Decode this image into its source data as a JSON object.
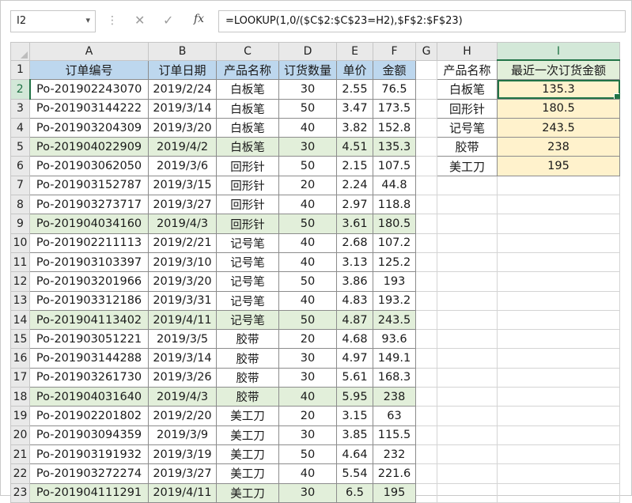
{
  "formula_bar": {
    "name_box": "I2",
    "name_box_arrow": "▾",
    "separator": "⋮",
    "cancel_icon": "✕",
    "confirm_icon": "✓",
    "fx_label": "fx",
    "formula": "=LOOKUP(1,0/($C$2:$C$23=H2),$F$2:$F$23)"
  },
  "columns": [
    "A",
    "B",
    "C",
    "D",
    "E",
    "F",
    "G",
    "H",
    "I"
  ],
  "selected_column": "I",
  "row_numbers": [
    "1",
    "2",
    "3",
    "4",
    "5",
    "6",
    "7",
    "8",
    "9",
    "10",
    "11",
    "12",
    "13",
    "14",
    "15",
    "16",
    "17",
    "18",
    "19",
    "20",
    "21",
    "22",
    "23"
  ],
  "selected_row": "2",
  "headers": [
    "订单编号",
    "订单日期",
    "产品名称",
    "订货数量",
    "单价",
    "金额"
  ],
  "orders": [
    {
      "id": "Po-201902243070",
      "date": "2019/2/24",
      "product": "白板笔",
      "qty": "30",
      "price": "2.55",
      "amount": "76.5",
      "latest": false
    },
    {
      "id": "Po-201903144222",
      "date": "2019/3/14",
      "product": "白板笔",
      "qty": "50",
      "price": "3.47",
      "amount": "173.5",
      "latest": false
    },
    {
      "id": "Po-201903204309",
      "date": "2019/3/20",
      "product": "白板笔",
      "qty": "40",
      "price": "3.82",
      "amount": "152.8",
      "latest": false
    },
    {
      "id": "Po-201904022909",
      "date": "2019/4/2",
      "product": "白板笔",
      "qty": "30",
      "price": "4.51",
      "amount": "135.3",
      "latest": true
    },
    {
      "id": "Po-201903062050",
      "date": "2019/3/6",
      "product": "回形针",
      "qty": "50",
      "price": "2.15",
      "amount": "107.5",
      "latest": false
    },
    {
      "id": "Po-201903152787",
      "date": "2019/3/15",
      "product": "回形针",
      "qty": "20",
      "price": "2.24",
      "amount": "44.8",
      "latest": false
    },
    {
      "id": "Po-201903273717",
      "date": "2019/3/27",
      "product": "回形针",
      "qty": "40",
      "price": "2.97",
      "amount": "118.8",
      "latest": false
    },
    {
      "id": "Po-201904034160",
      "date": "2019/4/3",
      "product": "回形针",
      "qty": "50",
      "price": "3.61",
      "amount": "180.5",
      "latest": true
    },
    {
      "id": "Po-201902211113",
      "date": "2019/2/21",
      "product": "记号笔",
      "qty": "40",
      "price": "2.68",
      "amount": "107.2",
      "latest": false
    },
    {
      "id": "Po-201903103397",
      "date": "2019/3/10",
      "product": "记号笔",
      "qty": "40",
      "price": "3.13",
      "amount": "125.2",
      "latest": false
    },
    {
      "id": "Po-201903201966",
      "date": "2019/3/20",
      "product": "记号笔",
      "qty": "50",
      "price": "3.86",
      "amount": "193",
      "latest": false
    },
    {
      "id": "Po-201903312186",
      "date": "2019/3/31",
      "product": "记号笔",
      "qty": "40",
      "price": "4.83",
      "amount": "193.2",
      "latest": false
    },
    {
      "id": "Po-201904113402",
      "date": "2019/4/11",
      "product": "记号笔",
      "qty": "50",
      "price": "4.87",
      "amount": "243.5",
      "latest": true
    },
    {
      "id": "Po-201903051221",
      "date": "2019/3/5",
      "product": "胶带",
      "qty": "20",
      "price": "4.68",
      "amount": "93.6",
      "latest": false
    },
    {
      "id": "Po-201903144288",
      "date": "2019/3/14",
      "product": "胶带",
      "qty": "30",
      "price": "4.97",
      "amount": "149.1",
      "latest": false
    },
    {
      "id": "Po-201903261730",
      "date": "2019/3/26",
      "product": "胶带",
      "qty": "30",
      "price": "5.61",
      "amount": "168.3",
      "latest": false
    },
    {
      "id": "Po-201904031640",
      "date": "2019/4/3",
      "product": "胶带",
      "qty": "40",
      "price": "5.95",
      "amount": "238",
      "latest": true
    },
    {
      "id": "Po-201902201802",
      "date": "2019/2/20",
      "product": "美工刀",
      "qty": "20",
      "price": "3.15",
      "amount": "63",
      "latest": false
    },
    {
      "id": "Po-201903094359",
      "date": "2019/3/9",
      "product": "美工刀",
      "qty": "30",
      "price": "3.85",
      "amount": "115.5",
      "latest": false
    },
    {
      "id": "Po-201903191932",
      "date": "2019/3/19",
      "product": "美工刀",
      "qty": "50",
      "price": "4.64",
      "amount": "232",
      "latest": false
    },
    {
      "id": "Po-201903272274",
      "date": "2019/3/27",
      "product": "美工刀",
      "qty": "40",
      "price": "5.54",
      "amount": "221.6",
      "latest": false
    },
    {
      "id": "Po-201904111291",
      "date": "2019/4/11",
      "product": "美工刀",
      "qty": "30",
      "price": "6.5",
      "amount": "195",
      "latest": true
    }
  ],
  "summary": {
    "headers": [
      "产品名称",
      "最近一次订货金额"
    ],
    "rows": [
      {
        "product": "白板笔",
        "value": "135.3"
      },
      {
        "product": "回形针",
        "value": "180.5"
      },
      {
        "product": "记号笔",
        "value": "243.5"
      },
      {
        "product": "胶带",
        "value": "238"
      },
      {
        "product": "美工刀",
        "value": "195"
      }
    ]
  },
  "colors": {
    "header_fill": "#bdd7ee",
    "latest_row_fill": "#e2efda",
    "summary_value_fill": "#fff2cc",
    "excel_green": "#217346"
  }
}
